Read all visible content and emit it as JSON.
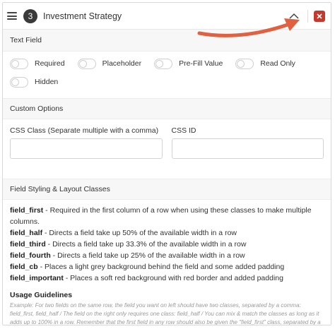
{
  "header": {
    "number": "3",
    "title": "Investment Strategy"
  },
  "text_field": {
    "heading": "Text Field",
    "toggles": [
      {
        "label": "Required"
      },
      {
        "label": "Placeholder"
      },
      {
        "label": "Pre-Fill Value"
      },
      {
        "label": "Read Only"
      },
      {
        "label": "Hidden"
      }
    ]
  },
  "custom_options": {
    "heading": "Custom Options",
    "css_class_label": "CSS Class (Separate multiple with a comma)",
    "css_id_label": "CSS ID"
  },
  "styling": {
    "heading": "Field Styling & Layout Classes",
    "items": [
      {
        "name": "field_first",
        "desc": " - Required in the first column of a row when using these classes to make multiple columns."
      },
      {
        "name": "field_half",
        "desc": " - Directs a field take up 50% of the available width in a row"
      },
      {
        "name": "field_third",
        "desc": " - Directs a field take up 33.3% of the available width in a row"
      },
      {
        "name": "field_fourth",
        "desc": " - Directs a field take up 25% of the available width in a row"
      },
      {
        "name": "field_cb",
        "desc": " - Places a light grey background behind the field and some added padding"
      },
      {
        "name": "field_important",
        "desc": " - Places a soft red background with red border and added padding"
      }
    ]
  },
  "guidelines": {
    "title": "Usage Guidelines",
    "text": "Example: For two fields on the same row, the field you want on left should have two classes, separated by a comma: field_first, field_half / The field on the right only requires one class: field_half / You can mix & match the classes as long as it adds up to 100% in a row. Remember that the first field in any row should also be given the \"field_first\" class, separated by a comma."
  },
  "colors": {
    "close_button": "#c3392e",
    "arrow": "#e0603f",
    "badge": "#3a3a3a"
  }
}
